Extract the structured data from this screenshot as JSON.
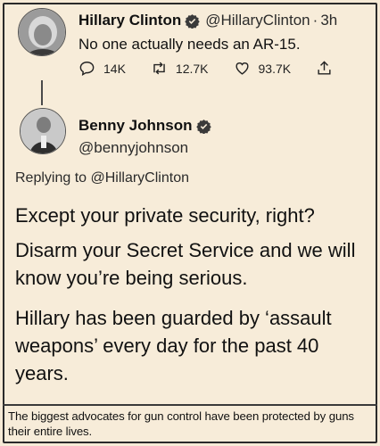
{
  "original_tweet": {
    "name": "Hillary Clinton",
    "handle": "@HillaryClinton",
    "separator": "·",
    "time": "3h",
    "text": "No one actually needs an AR-15.",
    "actions": {
      "replies": "14K",
      "retweets": "12.7K",
      "likes": "93.7K"
    }
  },
  "reply_tweet": {
    "name": "Benny Johnson",
    "handle": "@bennyjohnson",
    "replying_to": "Replying to @HillaryClinton",
    "paragraphs": [
      "Except your private security, right?",
      "Disarm your Secret Service and we will know you’re being serious.",
      "Hillary has been guarded by ‘assault weapons’ every day for the past 40 years."
    ]
  },
  "caption": "The biggest advocates for gun control have been protected by guns their entire lives.",
  "colors": {
    "background": "#f6ead6",
    "verified_badge": "#3a3a3a",
    "text": "#111111"
  },
  "icons": [
    "reply-icon",
    "retweet-icon",
    "like-icon",
    "share-icon",
    "verified-badge-icon"
  ]
}
